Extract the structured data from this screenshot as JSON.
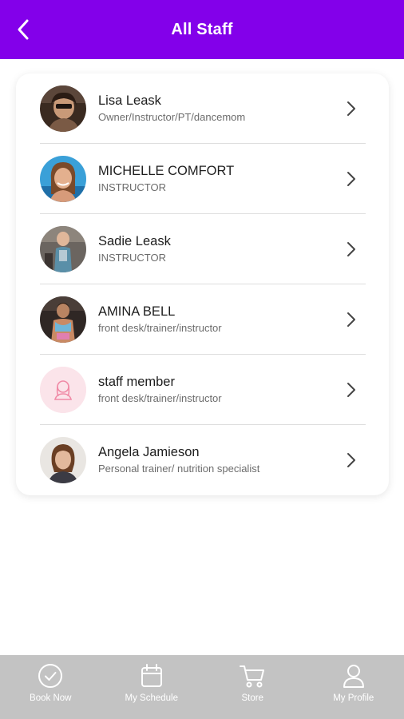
{
  "header": {
    "title": "All Staff",
    "back_icon": "chevron-left-icon",
    "background": "#8300ea"
  },
  "staff": [
    {
      "name": "Lisa Leask",
      "role": "Owner/Instructor/PT/dancemom",
      "avatar": "photo"
    },
    {
      "name": "MICHELLE COMFORT",
      "role": "INSTRUCTOR",
      "avatar": "photo"
    },
    {
      "name": "Sadie Leask",
      "role": "INSTRUCTOR",
      "avatar": "photo"
    },
    {
      "name": "AMINA BELL",
      "role": "front desk/trainer/instructor",
      "avatar": "photo"
    },
    {
      "name": "staff member",
      "role": "front desk/trainer/instructor",
      "avatar": "placeholder-person-icon"
    },
    {
      "name": "Angela Jamieson",
      "role": "Personal trainer/ nutrition specialist",
      "avatar": "photo"
    }
  ],
  "tabbar": {
    "background": "#c3c3c3",
    "items": [
      {
        "label": "Book Now",
        "icon": "check-circle-icon"
      },
      {
        "label": "My Schedule",
        "icon": "calendar-icon"
      },
      {
        "label": "Store",
        "icon": "cart-icon"
      },
      {
        "label": "My Profile",
        "icon": "user-icon"
      }
    ]
  }
}
